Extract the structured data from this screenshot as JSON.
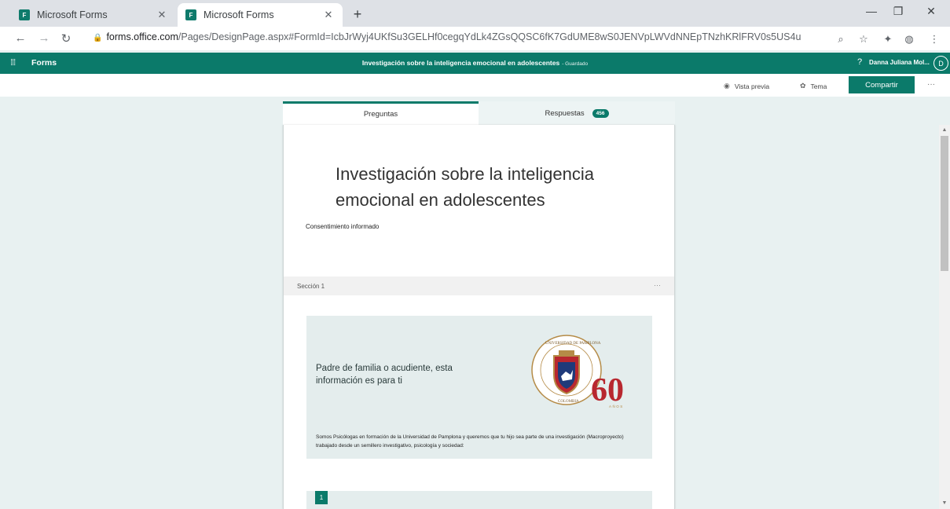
{
  "browser": {
    "tabs": [
      {
        "title": "Microsoft Forms",
        "active": false
      },
      {
        "title": "Microsoft Forms",
        "active": true
      }
    ],
    "url_host": "forms.office.com",
    "url_path": "/Pages/DesignPage.aspx#FormId=IcbJrWyj4UKfSu3GELHf0cegqYdLk4ZGsQQSC6fK7GdUME8wS0JENVpLWVdNNEpTNzhKRlFRV0s5US4u"
  },
  "forms_header": {
    "app_name": "Forms",
    "doc_title": "Investigación sobre la inteligencia emocional en adolescentes",
    "saved_status": "- Guardado",
    "help": "?",
    "user_name": "Danna Juliana Mol...",
    "avatar_initial": "D"
  },
  "command_bar": {
    "preview_label": "Vista previa",
    "theme_label": "Tema",
    "share_label": "Compartir",
    "more": "···"
  },
  "form_tabs": {
    "questions_label": "Preguntas",
    "responses_label": "Respuestas",
    "responses_count": "456"
  },
  "form": {
    "title": "Investigación sobre la inteligencia emocional en adolescentes",
    "description": "Consentimiento informado",
    "section_label": "Sección 1",
    "section_more": "···",
    "info_heading": "Padre de familia o acudiente, esta información es para ti",
    "info_body": "Somos Psicólogas en formación de la Universidad de Pamplona y queremos que tu hijo sea parte de una investigación (Macroproyecto) trabajado desde un semillero investigativo, psicología y sociedad:",
    "logo_top_text": "UNIVERSIDAD DE PAMPLONA",
    "logo_bottom_text": "COLOMBIA",
    "logo_badge": "60",
    "logo_badge_sub": "AÑOS",
    "question_number": "1"
  },
  "colors": {
    "brand": "#0b7a6a",
    "page_bg": "#e8f1f1",
    "block_bg": "#e4eded"
  }
}
